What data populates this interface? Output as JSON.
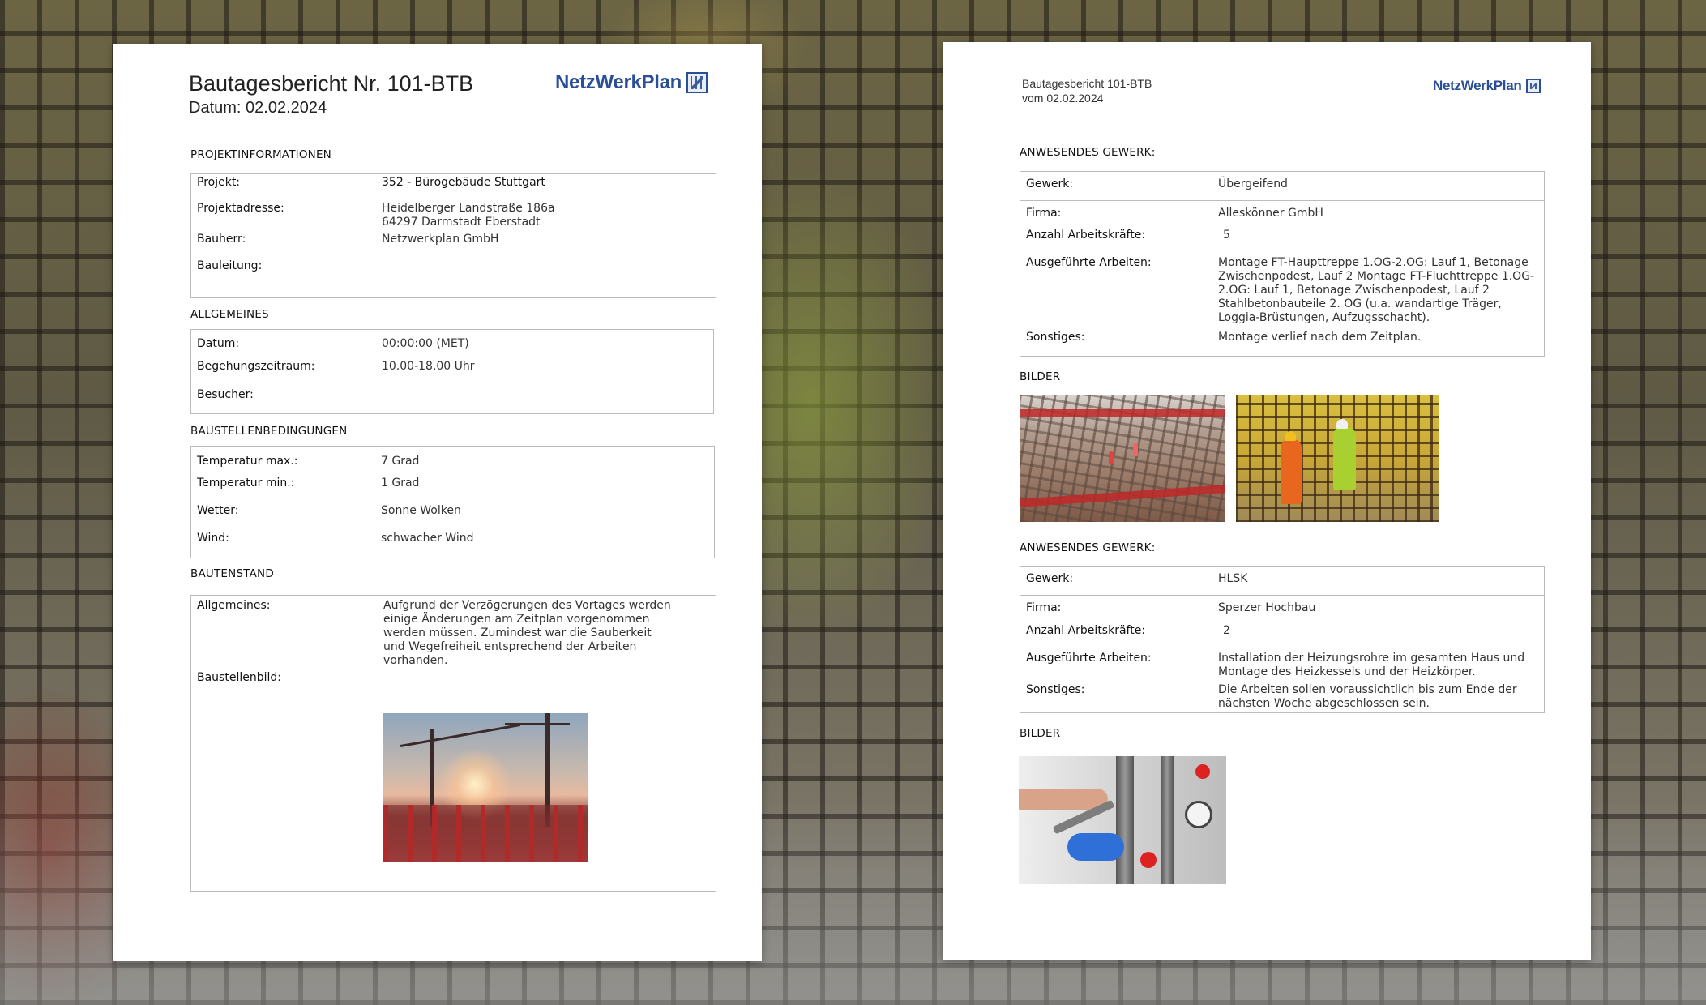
{
  "brand": {
    "name": "NetzWerkPlan",
    "color": "#2a4f96"
  },
  "left_page": {
    "title": "Bautagesbericht Nr. 101-BTB",
    "date_line": "Datum: 02.02.2024",
    "projektinfo": {
      "heading": "PROJEKTINFORMATIONEN",
      "projekt_label": "Projekt:",
      "projekt_value": "352 - Bürogebäude Stuttgart",
      "adresse_label": "Projektadresse:",
      "adresse_line1": "Heidelberger Landstraße 186a",
      "adresse_line2": "64297 Darmstadt Eberstadt",
      "bauherr_label": "Bauherr:",
      "bauherr_value": "Netzwerkplan GmbH",
      "bauleitung_label": "Bauleitung:"
    },
    "allgemeines": {
      "heading": "ALLGEMEINES",
      "datum_label": "Datum:",
      "datum_value": "00:00:00 (MET)",
      "zeitraum_label": "Begehungszeitraum:",
      "zeitraum_value": "10.00-18.00 Uhr",
      "besucher_label": "Besucher:"
    },
    "bedingungen": {
      "heading": "BAUSTELLENBEDINGUNGEN",
      "tmax_label": "Temperatur max.:",
      "tmax_value": "7 Grad",
      "tmin_label": "Temperatur min.:",
      "tmin_value": "1 Grad",
      "wetter_label": "Wetter:",
      "wetter_value": "Sonne Wolken",
      "wind_label": "Wind:",
      "wind_value": "schwacher Wind"
    },
    "bautenstand": {
      "heading": "BAUTENSTAND",
      "allgemeines_label": "Allgemeines:",
      "allgemeines_lines": [
        "Aufgrund der Verzögerungen des Vortages werden",
        "einige Änderungen am Zeitplan vorgenommen",
        "werden müssen. Zumindest war die Sauberkeit",
        "und Wegefreiheit entsprechend der Arbeiten",
        "vorhanden."
      ],
      "bild_label": "Baustellenbild:"
    }
  },
  "right_page": {
    "header_line1": "Bautagesbericht  101-BTB",
    "header_line2": "vom 02.02.2024",
    "gewerk1": {
      "heading": "ANWESENDES GEWERK:",
      "gewerk_label": "Gewerk:",
      "gewerk_value": "Übergeifend",
      "firma_label": "Firma:",
      "firma_value": "Alleskönner GmbH",
      "anzahl_label": "Anzahl Arbeitskräfte:",
      "anzahl_value": "5",
      "arbeiten_label": "Ausgeführte Arbeiten:",
      "arbeiten_lines": [
        "Montage FT-Haupttreppe 1.OG-2.OG: Lauf 1, Betonage",
        "Zwischenpodest, Lauf 2 Montage FT-Fluchttreppe 1.OG-",
        "2.OG: Lauf 1, Betonage Zwischenpodest, Lauf 2",
        "Stahlbetonbauteile 2. OG (u.a. wandartige Träger,",
        "Loggia-Brüstungen, Aufzugsschacht)."
      ],
      "sonstiges_label": "Sonstiges:",
      "sonstiges_value": "Montage verlief nach dem Zeitplan."
    },
    "bilder1_heading": "BILDER",
    "gewerk2": {
      "heading": "ANWESENDES GEWERK:",
      "gewerk_label": "Gewerk:",
      "gewerk_value": "HLSK",
      "firma_label": "Firma:",
      "firma_value": "Sperzer Hochbau",
      "anzahl_label": "Anzahl Arbeitskräfte:",
      "anzahl_value": "2",
      "arbeiten_label": "Ausgeführte Arbeiten:",
      "arbeiten_lines": [
        "Installation der Heizungsrohre im gesamten Haus und",
        "Montage des Heizkessels und der Heizkörper."
      ],
      "sonstiges_label": "Sonstiges:",
      "sonstiges_lines": [
        "Die Arbeiten sollen voraussichtlich bis zum Ende der",
        "nächsten Woche abgeschlossen sein."
      ]
    },
    "bilder2_heading": "BILDER"
  }
}
